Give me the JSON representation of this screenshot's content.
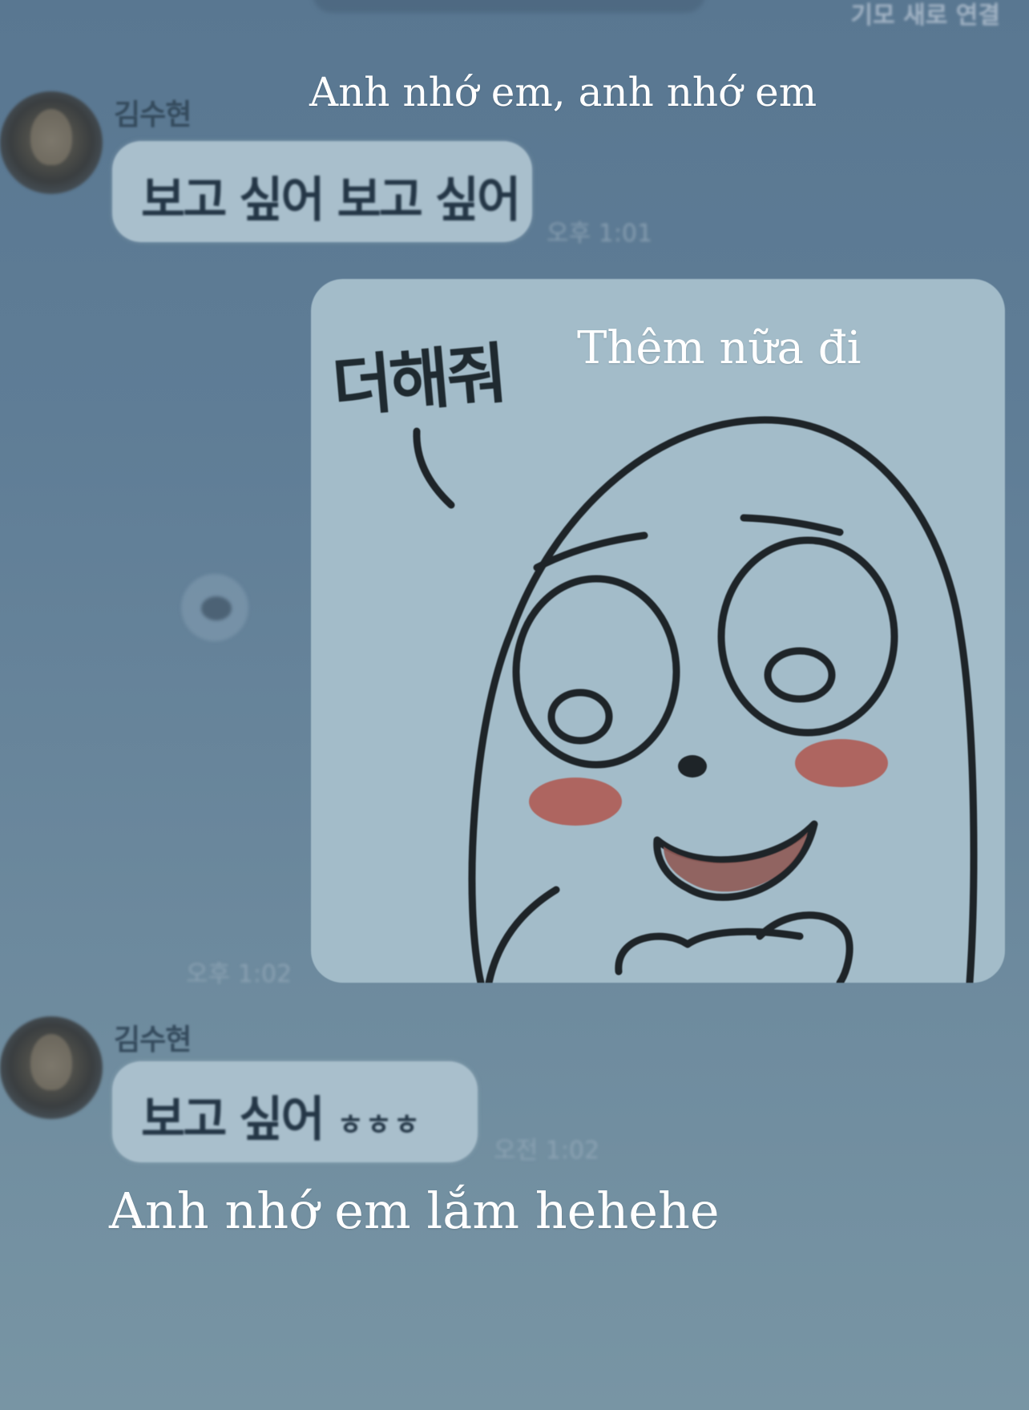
{
  "header": {
    "faded_text": "기모 새로 연결"
  },
  "messages": [
    {
      "sender": "김수현",
      "text": "보고 싶어 보고 싶어",
      "time": "오후 1:01"
    },
    {
      "type": "sticker",
      "sticker_text": "더해줘",
      "time": "오후 1:02"
    },
    {
      "sender": "김수현",
      "text": "보고 싶어",
      "text_suffix": "ㅎㅎㅎ",
      "time": "오전 1:02"
    }
  ],
  "captions": {
    "top": "Anh nhớ em, anh nhớ em",
    "sticker": "Thêm nữa đi",
    "bottom": "Anh nhớ em lắm hehehe"
  },
  "colors": {
    "background": "#5f7d96",
    "bubble": "#a9bfcc",
    "caption": "#ffffff",
    "cheek": "#b0564e"
  },
  "icons": {
    "avatar": "profile-photo",
    "side_dot": "reaction-bubble-icon"
  }
}
